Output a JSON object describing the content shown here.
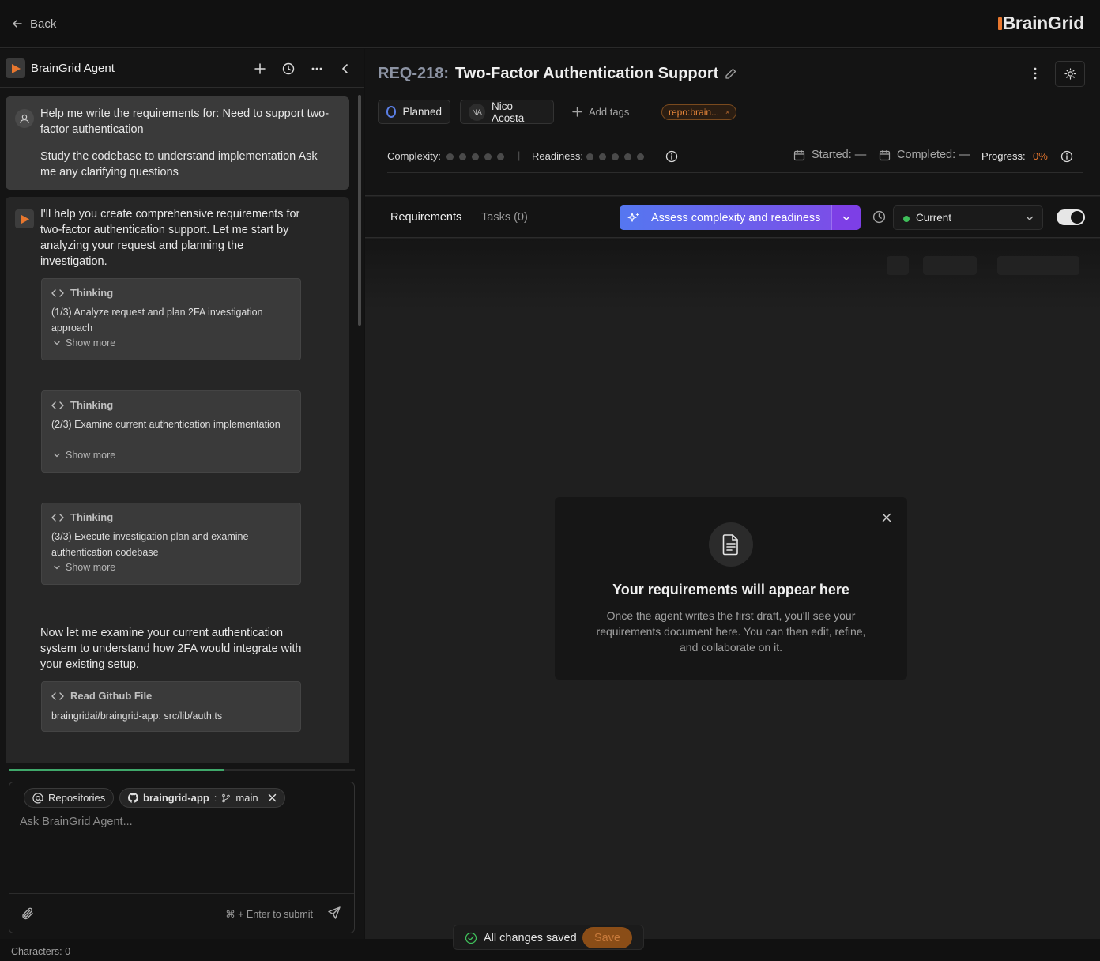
{
  "topbar": {
    "back_label": "Back",
    "logo_text": "BrainGrid"
  },
  "agent": {
    "title": "BrainGrid Agent",
    "user_message": {
      "line1": "Help me write the requirements for: Need to support two-factor authentication",
      "line2": "Study the codebase to understand implementation Ask me any clarifying questions"
    },
    "reply_intro": "I'll help you create comprehensive requirements for two-factor authentication support. Let me start by analyzing your request and planning the investigation.",
    "thinking": [
      {
        "title": "Thinking",
        "body": "(1/3) Analyze request and plan 2FA investigation approach",
        "more": "Show more"
      },
      {
        "title": "Thinking",
        "body": "(2/3) Examine current authentication implementation",
        "more": "Show more"
      },
      {
        "title": "Thinking",
        "body": "(3/3) Execute investigation plan and examine authentication codebase",
        "more": "Show more"
      }
    ],
    "reply_followup": "Now let me examine your current authentication system to understand how 2FA would integrate with your existing setup.",
    "read_file": {
      "title": "Read Github File",
      "body": "braingridai/braingrid-app: src/lib/auth.ts"
    },
    "progress_fraction": 0.62
  },
  "input": {
    "repositories_label": "Repositories",
    "repo_name": "braingrid-app",
    "repo_sep": ":",
    "branch": "main",
    "placeholder": "Ask BrainGrid Agent...",
    "submit_hint": "⌘ + Enter to submit"
  },
  "requirement": {
    "id": "REQ-218:",
    "title": "Two-Factor Authentication Support",
    "status": "Planned",
    "assignee_initials": "NA",
    "assignee_name": "Nico Acosta",
    "add_tags_label": "Add tags",
    "repo_tag": "repo:brain...",
    "complexity_label": "Complexity:",
    "readiness_label": "Readiness:",
    "started_label": "Started: —",
    "completed_label": "Completed: —",
    "progress_label": "Progress:",
    "progress_value": "0%"
  },
  "tabs": {
    "requirements": "Requirements",
    "tasks": "Tasks (0)",
    "assess_label": "Assess complexity and readiness",
    "version": "Current"
  },
  "empty_state": {
    "title": "Your requirements will appear here",
    "description": "Once the agent writes the first draft, you'll see your requirements document here. You can then edit, refine, and collaborate on it."
  },
  "savebar": {
    "status": "All changes saved",
    "save_label": "Save"
  },
  "statusbar": {
    "characters": "Characters: 0"
  },
  "colors": {
    "accent": "#e8772e",
    "assess_from": "#5577f0",
    "assess_to": "#7a4fe8",
    "status_ring": "#5b7fe6",
    "current_dot": "#3fbf5a"
  }
}
